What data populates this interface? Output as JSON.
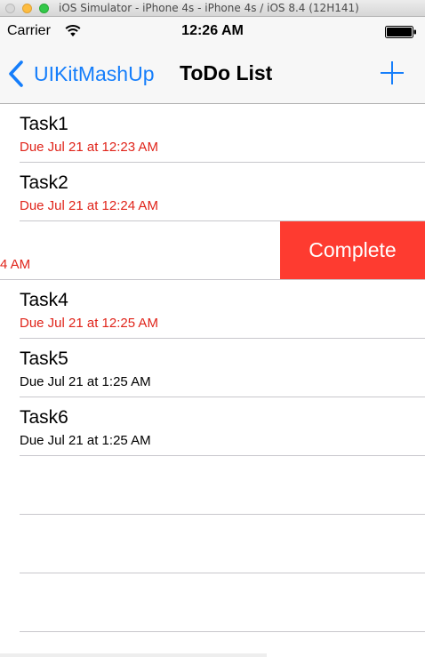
{
  "window": {
    "title": "iOS Simulator - iPhone 4s - iPhone 4s / iOS 8.4 (12H141)"
  },
  "status_bar": {
    "carrier": "Carrier",
    "time": "12:26 AM",
    "icons": [
      "wifi-icon",
      "battery-icon"
    ]
  },
  "nav": {
    "back_label": "UIKitMashUp",
    "title": "ToDo List",
    "add_icon": "plus-icon",
    "tint_color": "#157efb"
  },
  "tasks": [
    {
      "title": "Task1",
      "due": "Due Jul 21 at 12:23 AM",
      "overdue": true
    },
    {
      "title": "Task2",
      "due": "Due Jul 21 at 12:24 AM",
      "overdue": true
    },
    {
      "title": "",
      "due": "4 AM",
      "overdue": true,
      "swiped": true,
      "action_label": "Complete"
    },
    {
      "title": "Task4",
      "due": "Due Jul 21 at 12:25 AM",
      "overdue": true
    },
    {
      "title": "Task5",
      "due": "Due Jul 21 at 1:25 AM",
      "overdue": false
    },
    {
      "title": "Task6",
      "due": "Due Jul 21 at 1:25 AM",
      "overdue": false
    }
  ],
  "colors": {
    "overdue": "#e0241a",
    "complete_action": "#fe3b30",
    "separator": "#c8c7cc"
  }
}
